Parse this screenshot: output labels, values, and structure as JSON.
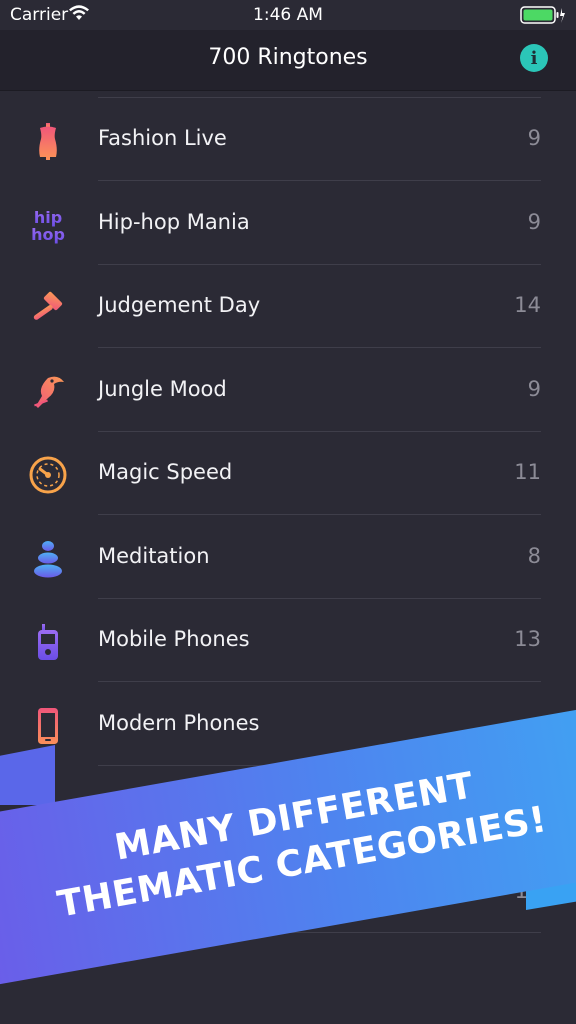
{
  "status_bar": {
    "carrier": "Carrier",
    "time": "1:46 AM"
  },
  "nav": {
    "title": "700 Ringtones",
    "info_icon": "info-icon"
  },
  "categories": [
    {
      "label": "Fashion Live",
      "count": "9",
      "icon": "mannequin-icon"
    },
    {
      "label": "Hip-hop Mania",
      "count": "9",
      "icon": "hip-hop-icon"
    },
    {
      "label": "Judgement Day",
      "count": "14",
      "icon": "gavel-icon"
    },
    {
      "label": "Jungle Mood",
      "count": "9",
      "icon": "toucan-icon"
    },
    {
      "label": "Magic Speed",
      "count": "11",
      "icon": "speedometer-icon"
    },
    {
      "label": "Meditation",
      "count": "8",
      "icon": "zen-stones-icon"
    },
    {
      "label": "Mobile Phones",
      "count": "13",
      "icon": "mobile-phone-icon"
    },
    {
      "label": "Modern Phones",
      "count": "",
      "icon": "smartphone-icon"
    }
  ],
  "partially_hidden_count": "1",
  "banner": {
    "line1": "MANY DIFFERENT",
    "line2": "THEMATIC CATEGORIES!"
  },
  "colors": {
    "background": "#2b2a35",
    "nav_background": "#23222c",
    "accent_info": "#2bc6b8",
    "banner_start": "#6d5ae8",
    "banner_end": "#3fa6f3"
  }
}
